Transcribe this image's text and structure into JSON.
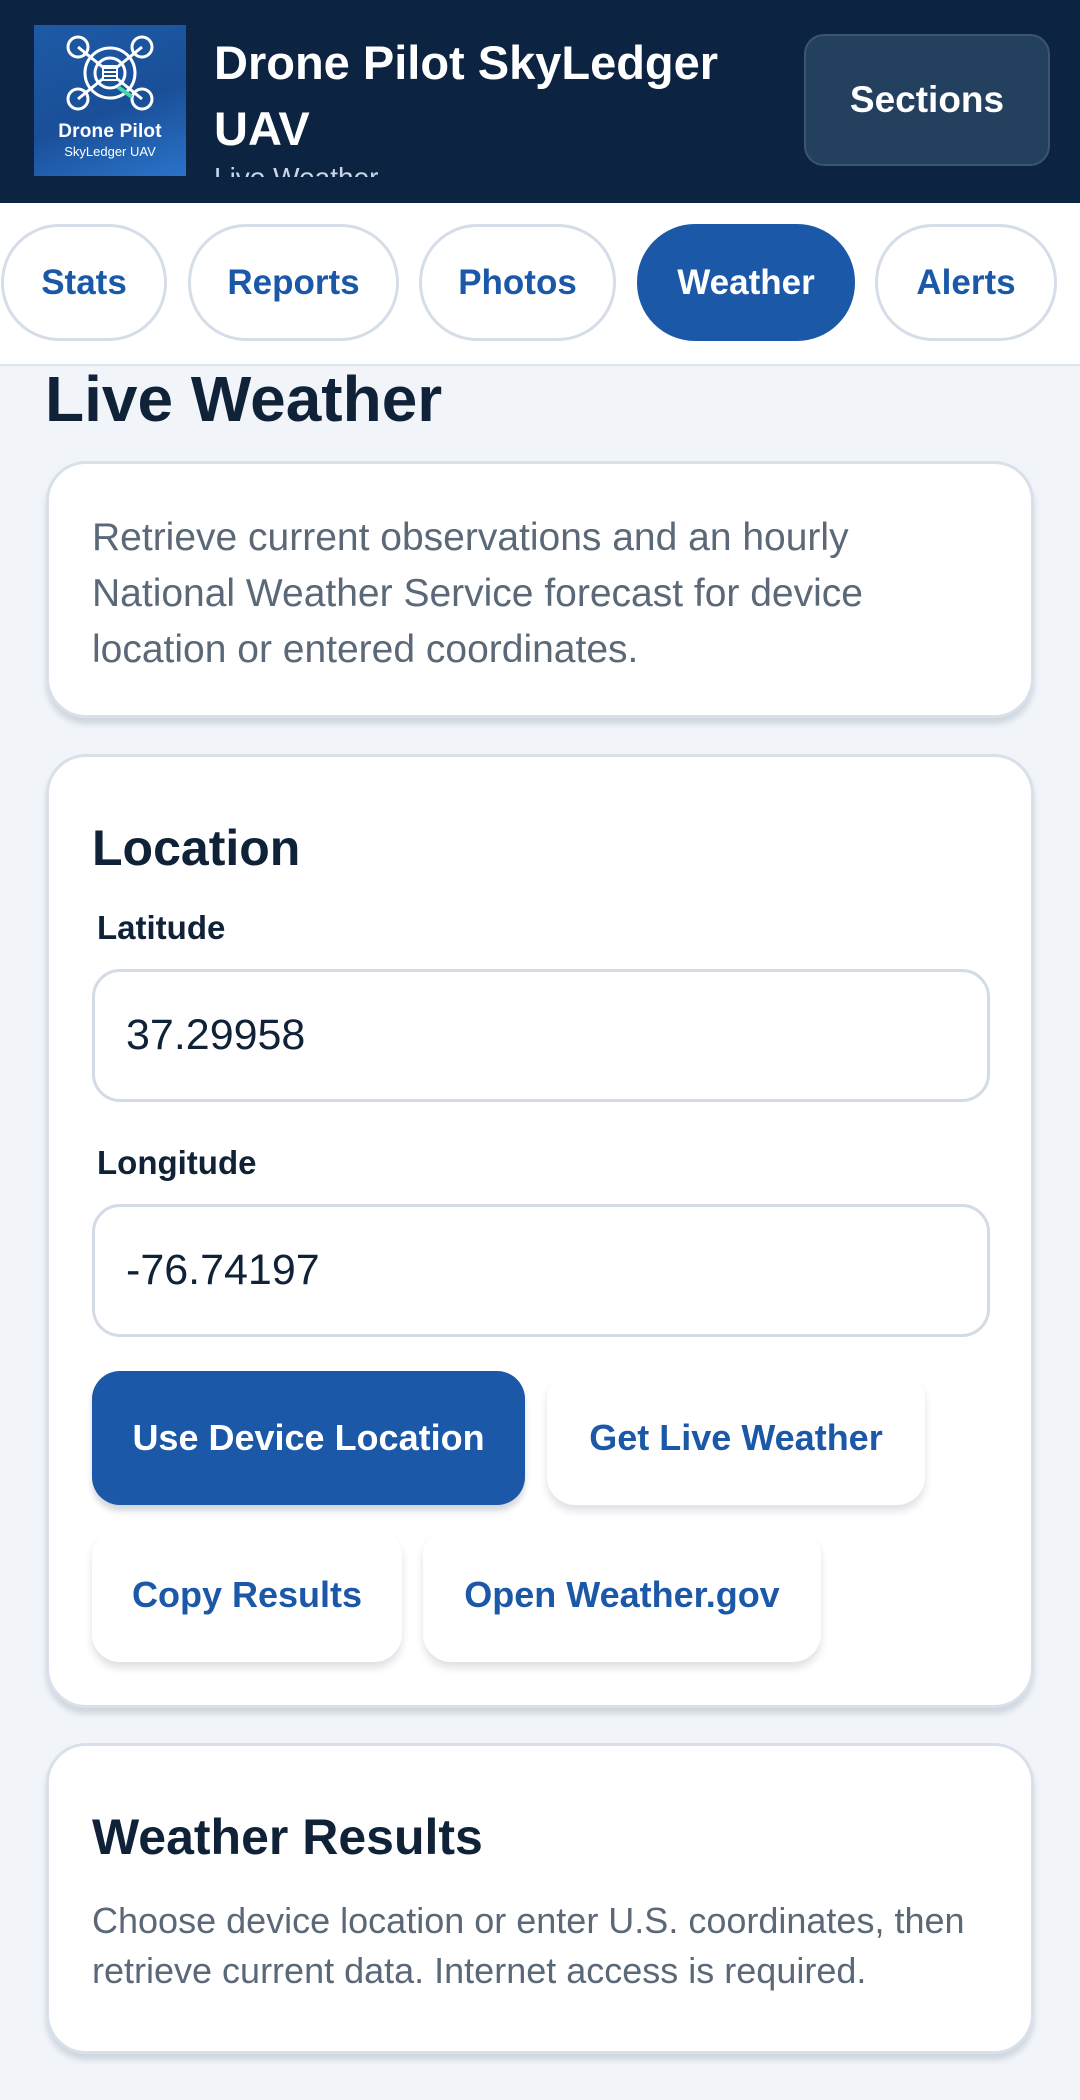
{
  "header": {
    "logo": {
      "line1": "Drone Pilot",
      "line2": "SkyLedger UAV"
    },
    "title": "Drone Pilot SkyLedger UAV",
    "subtitle": "Live Weather",
    "sections_button": "Sections"
  },
  "tabs": [
    {
      "label": "Stats",
      "active": false
    },
    {
      "label": "Reports",
      "active": false
    },
    {
      "label": "Photos",
      "active": false
    },
    {
      "label": "Weather",
      "active": true
    },
    {
      "label": "Alerts",
      "active": false
    }
  ],
  "page": {
    "heading": "Live Weather",
    "intro": "Retrieve current observations and an hourly National Weather Service forecast for device location or entered coordinates."
  },
  "location": {
    "title": "Location",
    "latitude_label": "Latitude",
    "latitude_value": "37.29958",
    "longitude_label": "Longitude",
    "longitude_value": "-76.74197",
    "buttons": {
      "use_device": "Use Device Location",
      "get_weather": "Get Live Weather",
      "copy": "Copy Results",
      "open_gov": "Open Weather.gov"
    }
  },
  "results": {
    "title": "Weather Results",
    "text": "Choose device location or enter U.S. coordinates, then retrieve current data. Internet access is required."
  },
  "colors": {
    "header_bg": "#0c2442",
    "accent": "#1b58a8",
    "page_bg": "#f1f5fa"
  }
}
